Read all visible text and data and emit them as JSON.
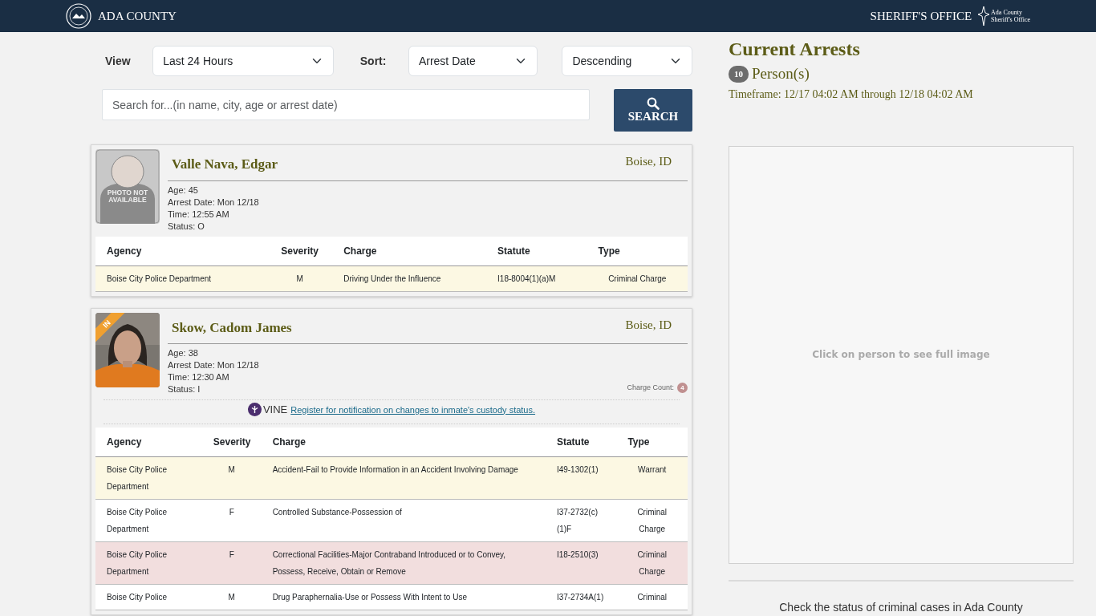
{
  "header": {
    "left_title": "ADA COUNTY",
    "right_title": "SHERIFF'S OFFICE",
    "logo_text": [
      "Ada County",
      "Sheriff's Office"
    ]
  },
  "filters": {
    "view_label": "View",
    "view_value": "Last 24 Hours",
    "sort_label": "Sort:",
    "sort_value": "Arrest Date",
    "order_value": "Descending"
  },
  "search": {
    "placeholder": "Search for...(in name, city, age or arrest date)",
    "button": "SEARCH"
  },
  "arrests": [
    {
      "name": "Valle Nava, Edgar",
      "city": "Boise, ID",
      "photo": {
        "kind": "placeholder",
        "text": "PHOTO NOT AVAILABLE"
      },
      "details": [
        "Age: 45",
        "Arrest Date: Mon 12/18",
        "Time: 12:55 AM",
        "Status: O"
      ],
      "columns": [
        "Agency",
        "Severity",
        "Charge",
        "Statute",
        "Type"
      ],
      "charges": [
        {
          "color": "#fcf8e3",
          "cells": [
            "Boise City Police Department",
            "M",
            "Driving Under the Influence",
            "I18-8004(1)(a)M",
            "Criminal Charge"
          ]
        }
      ]
    },
    {
      "name": "Skow, Cadom James",
      "city": "Boise, ID",
      "custody_badge": "IN",
      "photo": {
        "kind": "picture"
      },
      "details": [
        "Age: 38",
        "Arrest Date: Mon 12/18",
        "Time: 12:30 AM",
        "Status: I"
      ],
      "charge_count_label": "Charge Count:",
      "charge_count": "4",
      "vine": {
        "logo": "VINE",
        "link": "Register for notification on changes to inmate's custody status."
      },
      "columns": [
        "Agency",
        "Severity",
        "Charge",
        "Statute",
        "Type"
      ],
      "charges": [
        {
          "color": "#fcf8e3",
          "cells": [
            "Boise City Police Department",
            "M",
            "Accident-Fail to Provide Information in an Accident Involving Damage",
            "I49-1302(1)",
            "Warrant"
          ]
        },
        {
          "color": "#ffffff",
          "cells": [
            "Boise City Police Department",
            "F",
            "Controlled Substance-Possession of",
            "I37-2732(c)(1)F",
            "Criminal Charge"
          ]
        },
        {
          "color": "#f2dede",
          "cells": [
            "Boise City Police Department",
            "F",
            "Correctional Facilities-Major Contraband Introduced or to Convey, Possess, Receive, Obtain or Remove",
            "I18-2510(3)",
            "Criminal Charge"
          ]
        },
        {
          "color": "#ffffff",
          "cells": [
            "Boise City Police",
            "M",
            "Drug Paraphernalia-Use or Possess With Intent to Use",
            "I37-2734A(1)",
            "Criminal"
          ]
        }
      ]
    }
  ],
  "summary": {
    "title": "Current Arrests",
    "count": "10",
    "count_label": "Person(s)",
    "timeframe": "Timeframe: 12/17 04:02 AM through 12/18 04:02 AM"
  },
  "image_panel": {
    "hint": "Click on person to see full image"
  },
  "footer_note": "Check the status of criminal cases in Ada County"
}
